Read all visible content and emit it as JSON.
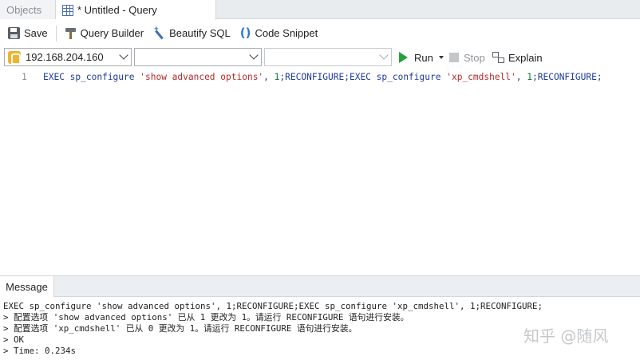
{
  "tabs": {
    "objects_label": "Objects",
    "query_label": "* Untitled - Query"
  },
  "toolbar": {
    "save_label": "Save",
    "query_builder_label": "Query Builder",
    "beautify_label": "Beautify SQL",
    "snippet_label": "Code Snippet",
    "icons": [
      "save-icon",
      "hammer-icon",
      "wand-icon",
      "parentheses-icon"
    ]
  },
  "selectors": {
    "connection": "192.168.204.160",
    "database": "",
    "schema": ""
  },
  "actions": {
    "run_label": "Run",
    "stop_label": "Stop",
    "explain_label": "Explain"
  },
  "editor": {
    "line_number": "1",
    "segments": [
      {
        "text": "EXEC sp_configure ",
        "kind": "kw"
      },
      {
        "text": "'show advanced options'",
        "kind": "str"
      },
      {
        "text": ", ",
        "kind": "kw"
      },
      {
        "text": "1",
        "kind": "num"
      },
      {
        "text": ";RECONFIGURE;EXEC sp_configure ",
        "kind": "kw"
      },
      {
        "text": "'xp_cmdshell'",
        "kind": "str"
      },
      {
        "text": ", ",
        "kind": "kw"
      },
      {
        "text": "1",
        "kind": "num"
      },
      {
        "text": ";RECONFIGURE;",
        "kind": "kw"
      }
    ]
  },
  "messages": {
    "tab_label": "Message",
    "lines": [
      "EXEC sp_configure 'show advanced options', 1;RECONFIGURE;EXEC sp_configure 'xp_cmdshell', 1;RECONFIGURE;",
      "> 配置选项 'show advanced options' 已从 1 更改为 1。请运行 RECONFIGURE 语句进行安装。",
      "> 配置选项 'xp_cmdshell' 已从 0 更改为 1。请运行 RECONFIGURE 语句进行安装。",
      "> OK",
      "> Time: 0.234s"
    ]
  },
  "watermark": "知乎 @随风",
  "colors": {
    "keyword": "#1d3b9e",
    "string": "#b52a2a",
    "number": "#0a7a3a",
    "run_icon": "#22a33a"
  }
}
